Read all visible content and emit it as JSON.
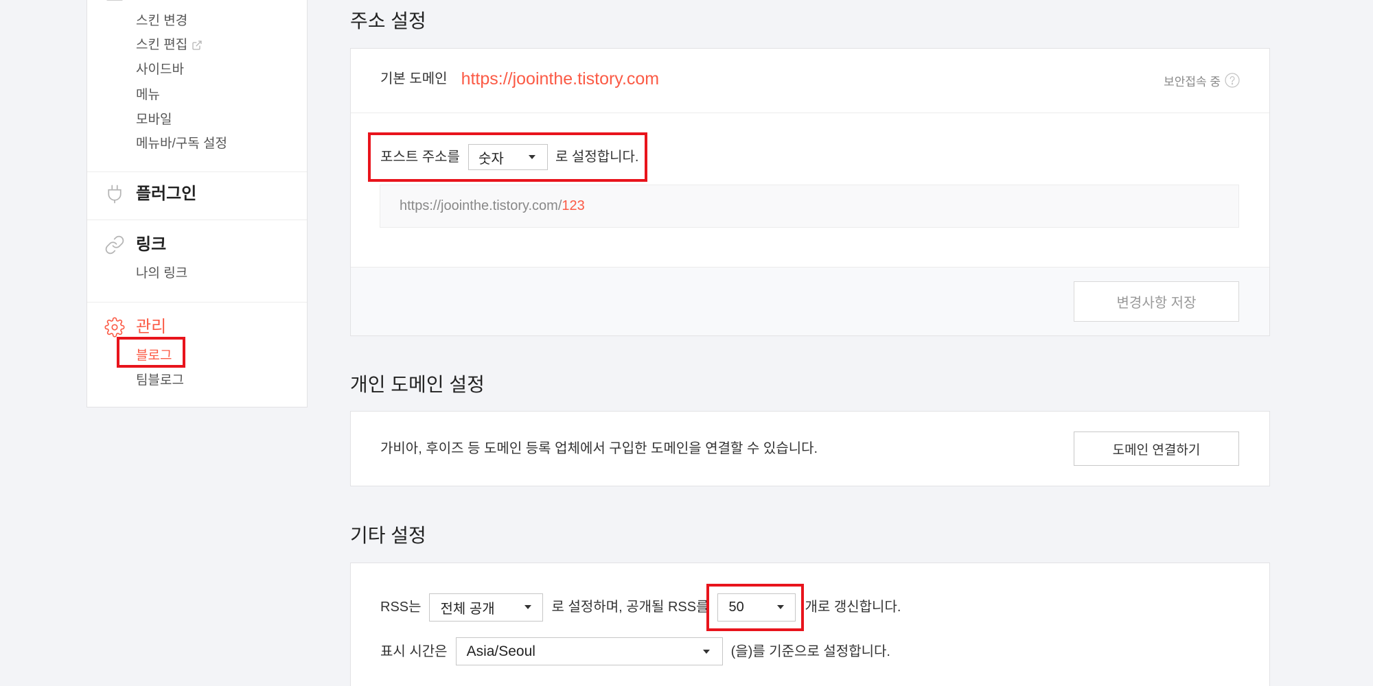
{
  "colors": {
    "accent": "#fb5a45",
    "highlight": "#e8141c",
    "background": "#f3f4f7"
  },
  "sidebar": {
    "customize": {
      "icon": "customize-icon",
      "items": [
        {
          "label": "스킨 변경"
        },
        {
          "label": "스킨 편집",
          "icon": "external-link-icon"
        },
        {
          "label": "사이드바"
        },
        {
          "label": "메뉴"
        },
        {
          "label": "모바일"
        },
        {
          "label": "메뉴바/구독 설정"
        }
      ]
    },
    "plugin": {
      "label": "플러그인",
      "icon": "plug-icon"
    },
    "link": {
      "label": "링크",
      "icon": "link-icon",
      "items": [
        {
          "label": "나의 링크"
        }
      ]
    },
    "manage": {
      "label": "관리",
      "icon": "gear-icon",
      "active": true,
      "items": [
        {
          "label": "블로그",
          "active": true
        },
        {
          "label": "팀블로그"
        }
      ]
    }
  },
  "address_settings": {
    "title": "주소 설정",
    "default_domain_label": "기본 도메인",
    "default_domain": "https://joointhe.tistory.com",
    "secure_status": "보안접속 중",
    "post_address_prefix": "포스트 주소를",
    "post_address_select": "숫자",
    "post_address_suffix": "로 설정합니다.",
    "preview_base": "https://joointhe.tistory.com/",
    "preview_id": "123",
    "save_button": "변경사항 저장"
  },
  "custom_domain": {
    "title": "개인 도메인 설정",
    "description": "가비아, 후이즈 등 도메인 등록 업체에서 구입한 도메인을 연결할 수 있습니다.",
    "connect_button": "도메인 연결하기"
  },
  "other_settings": {
    "title": "기타 설정",
    "rss_prefix": "RSS는",
    "rss_visibility": "전체 공개",
    "rss_middle": "로 설정하며, 공개될 RSS를",
    "rss_count": "50",
    "rss_suffix": "개로 갱신합니다.",
    "time_prefix": "표시 시간은",
    "timezone": "Asia/Seoul",
    "time_suffix": "(을)를 기준으로 설정합니다."
  }
}
